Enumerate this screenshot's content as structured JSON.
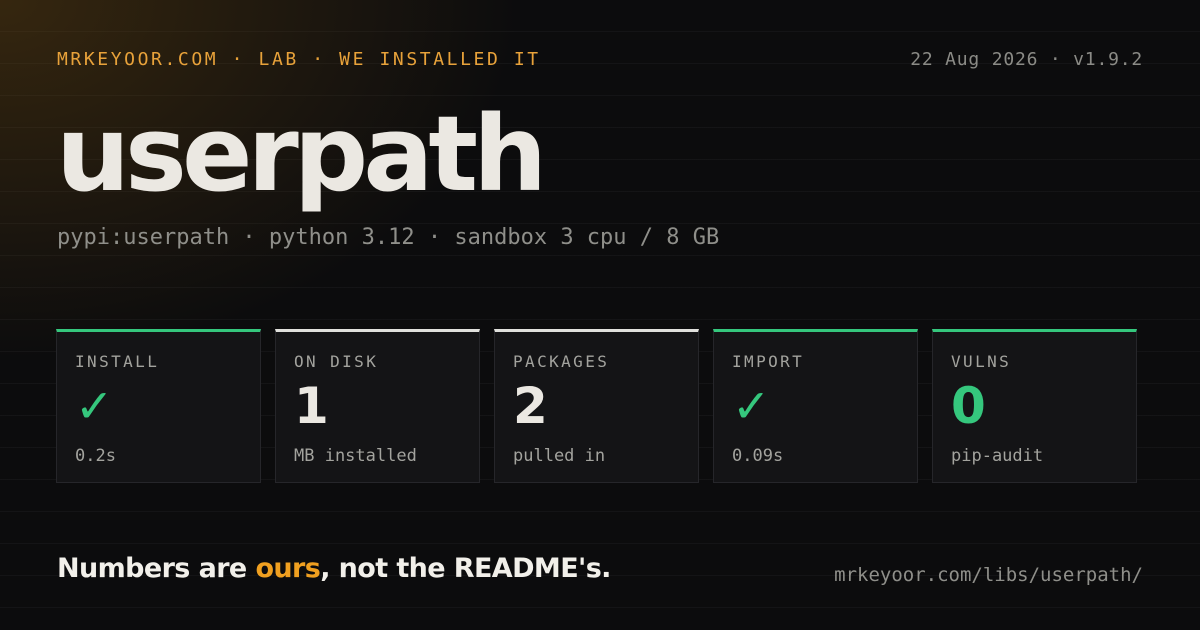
{
  "header": {
    "kicker": "MRKEYOOR.COM · LAB · WE INSTALLED IT",
    "meta": "22 Aug 2026 · v1.9.2"
  },
  "title": "userpath",
  "subtitle": "pypi:userpath · python 3.12 · sandbox 3 cpu / 8 GB",
  "stats": [
    {
      "label": "INSTALL",
      "value": "✓",
      "note": "0.2s",
      "accent": "#35c77d",
      "icon": "check-icon"
    },
    {
      "label": "ON DISK",
      "value": "1",
      "note": "MB installed",
      "accent": "#e0e0dc"
    },
    {
      "label": "PACKAGES",
      "value": "2",
      "note": "pulled in",
      "accent": "#e0e0dc"
    },
    {
      "label": "IMPORT",
      "value": "✓",
      "note": "0.09s",
      "accent": "#35c77d",
      "icon": "check-icon"
    },
    {
      "label": "VULNS",
      "value": "0",
      "note": "pip-audit",
      "accent": "#35c77d"
    }
  ],
  "footer": {
    "tagline_before": "Numbers are ",
    "tagline_highlight": "ours",
    "tagline_after": ", not the README's.",
    "url": "mrkeyoor.com/libs/userpath/"
  },
  "colors": {
    "background": "#0c0c0d",
    "amber": "#e8a23a",
    "highlight": "#f0a020",
    "green": "#35c77d",
    "text": "#ebe8e2",
    "muted": "#8f8f8a"
  }
}
